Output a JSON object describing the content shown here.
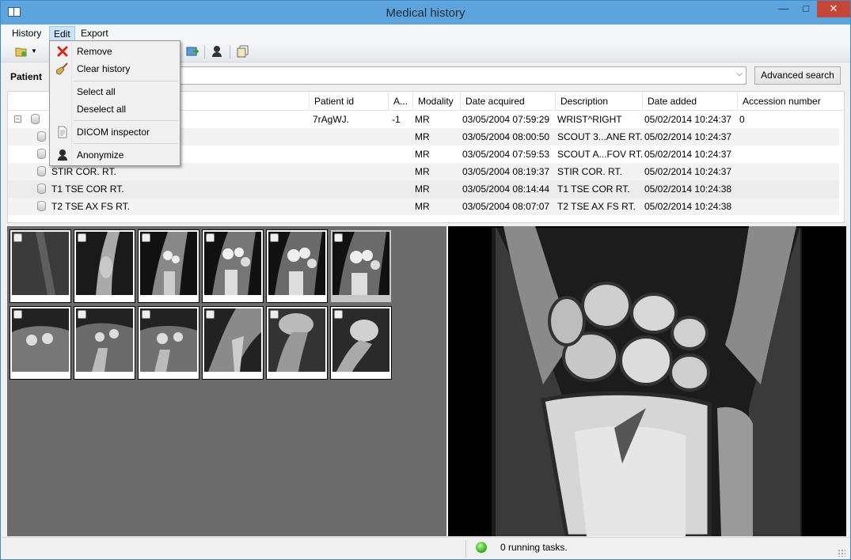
{
  "window": {
    "title": "Medical history"
  },
  "menu": {
    "items": [
      "History",
      "Edit",
      "Export"
    ]
  },
  "edit_menu": {
    "remove": "Remove",
    "clear_history": "Clear history",
    "select_all": "Select all",
    "deselect_all": "Deselect all",
    "dicom_inspector": "DICOM inspector",
    "anonymize": "Anonymize"
  },
  "patient": {
    "label": "Patient",
    "value": "",
    "advanced_search": "Advanced search"
  },
  "table": {
    "headers": [
      "Patient id",
      "A...",
      "Modality",
      "Date acquired",
      "Description",
      "Date added",
      "Accession number"
    ],
    "rows": [
      {
        "name": "",
        "patient_id": "7rAgWJ.",
        "age": "-1",
        "modality": "MR",
        "date_acquired": "03/05/2004 07:59:29",
        "description": "WRIST^RIGHT",
        "date_added": "05/02/2014 10:24:37",
        "accession": "0"
      },
      {
        "name": "",
        "patient_id": "",
        "age": "",
        "modality": "MR",
        "date_acquired": "03/05/2004 08:00:50",
        "description": "SCOUT 3...ANE RT.",
        "date_added": "05/02/2014 10:24:37",
        "accession": ""
      },
      {
        "name": "",
        "patient_id": "",
        "age": "",
        "modality": "MR",
        "date_acquired": "03/05/2004 07:59:53",
        "description": "SCOUT A...FOV RT.",
        "date_added": "05/02/2014 10:24:37",
        "accession": ""
      },
      {
        "name": "STIR COR. RT.",
        "patient_id": "",
        "age": "",
        "modality": "MR",
        "date_acquired": "03/05/2004 08:19:37",
        "description": "STIR COR. RT.",
        "date_added": "05/02/2014 10:24:37",
        "accession": ""
      },
      {
        "name": "T1 TSE COR RT.",
        "patient_id": "",
        "age": "",
        "modality": "MR",
        "date_acquired": "03/05/2004 08:14:44",
        "description": "T1 TSE COR RT.",
        "date_added": "05/02/2014 10:24:38",
        "accession": ""
      },
      {
        "name": "T2 TSE AX FS RT.",
        "patient_id": "",
        "age": "",
        "modality": "MR",
        "date_acquired": "03/05/2004 08:07:07",
        "description": "T2 TSE AX FS RT.",
        "date_added": "05/02/2014 10:24:38",
        "accession": ""
      }
    ]
  },
  "status": {
    "text": "0 running tasks.",
    "led_color": "#3cb81f"
  },
  "colors": {
    "titlebar": "#5ea4dc",
    "close_button": "#c7463a",
    "menu_active": "#cce4f7",
    "thumb_panel": "#6c6c6c"
  },
  "icons": {
    "title": "book-icon",
    "remove": "red-x-icon",
    "clear": "broom-icon",
    "inspector": "document-icon",
    "anonymize": "user-silhouette-icon"
  }
}
